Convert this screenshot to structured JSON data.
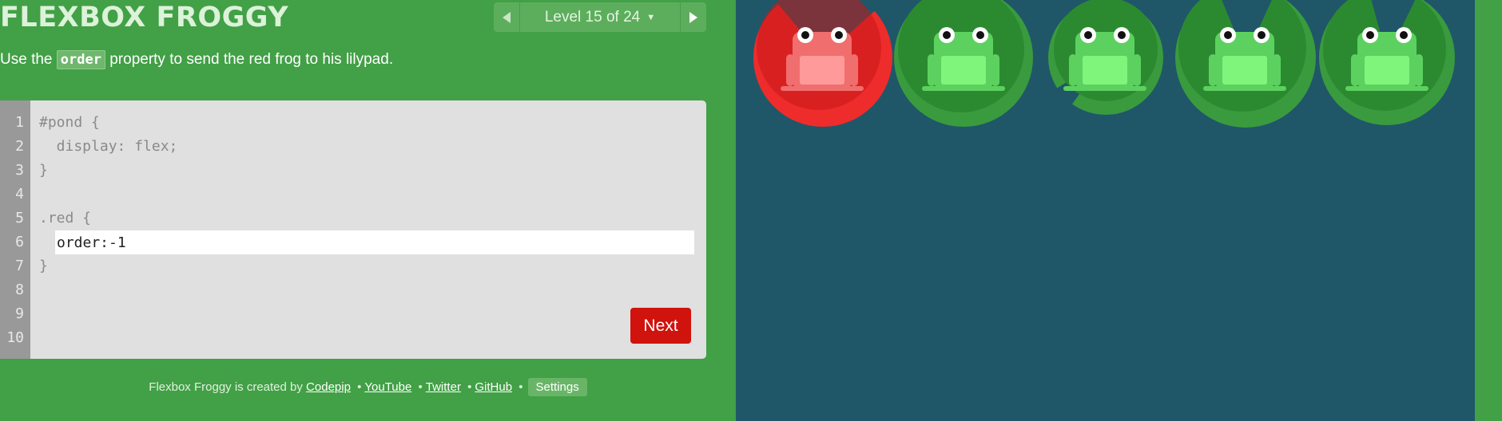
{
  "app": {
    "title": "FLEXBOX FROGGY",
    "level_label": "Level 15 of 24"
  },
  "instructions": {
    "before": "Use the ",
    "code": "order",
    "after": " property to send the red frog to his lilypad."
  },
  "editor": {
    "line_numbers": [
      "1",
      "2",
      "3",
      "4",
      "5",
      "6",
      "7",
      "8",
      "9",
      "10"
    ],
    "lines": [
      "#pond {",
      "  display: flex;",
      "}",
      "",
      ".red {"
    ],
    "input_value": "order:-1",
    "closing": "}",
    "next_label": "Next"
  },
  "footer": {
    "prefix": "Flexbox Froggy is created by",
    "links": [
      "Codepip",
      "YouTube",
      "Twitter",
      "GitHub"
    ],
    "separator": "•",
    "settings_label": "Settings"
  },
  "colors": {
    "sidebar_bg": "#42a046",
    "pond_bg": "#1f5768",
    "red_frog": "#f06e6e",
    "green_frog": "#5cd160",
    "next_button": "#d0130d"
  },
  "frogs": [
    {
      "color": "red",
      "lilypad": "red"
    },
    {
      "color": "green",
      "lilypad": "green"
    },
    {
      "color": "green",
      "lilypad": "green"
    },
    {
      "color": "green",
      "lilypad": "green"
    },
    {
      "color": "green",
      "lilypad": "green"
    }
  ]
}
